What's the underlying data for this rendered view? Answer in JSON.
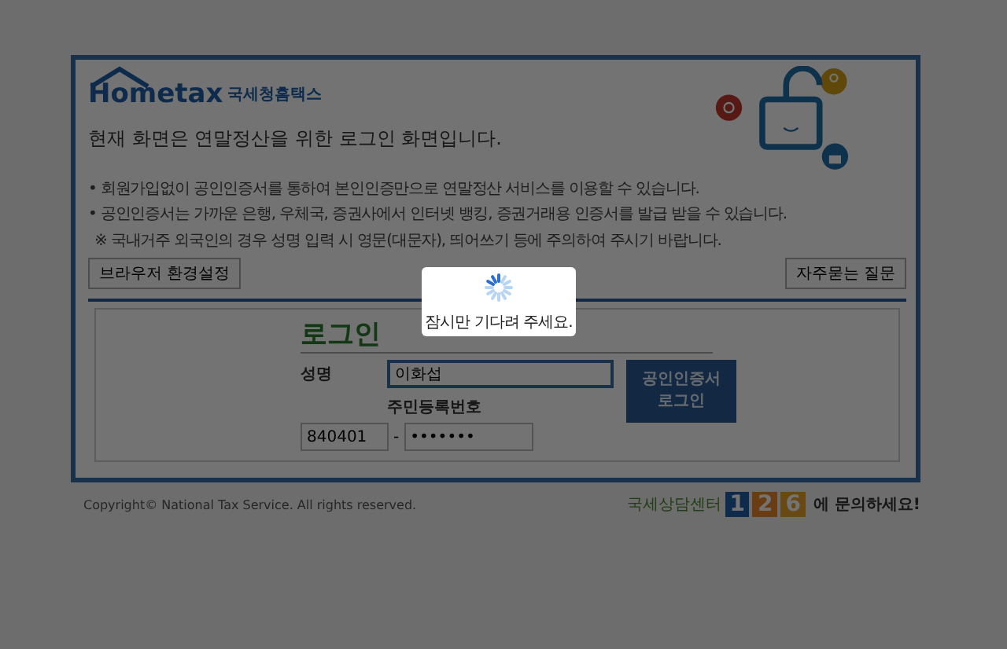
{
  "header": {
    "logo_text": "Hometax",
    "logo_subtitle": "국세청홈택스",
    "title": "현재 화면은 연말정산을 위한 로그인 화면입니다."
  },
  "notices": [
    {
      "kind": "bullet",
      "marker": "•",
      "text": "회원가입없이 공인인증서를 통하여 본인인증만으로 연말정산 서비스를 이용할 수 있습니다."
    },
    {
      "kind": "bullet",
      "marker": "•",
      "text": "공인인증서는 가까운 은행, 우체국, 증권사에서 인터넷 뱅킹, 증권거래용 인증서를 발급 받을 수 있습니다."
    },
    {
      "kind": "note",
      "marker": "※",
      "text": "국내거주 외국인의 경우 성명 입력 시 영문(대문자), 띄어쓰기 등에 주의하여 주시기 바랍니다."
    }
  ],
  "buttons": {
    "browser_settings": "브라우저 환경설정",
    "faq": "자주묻는 질문"
  },
  "login": {
    "title": "로그인",
    "name_label": "성명",
    "name_value": "이화섭",
    "id_label": "주민등록번호",
    "id_front": "840401",
    "separator": "-",
    "id_back": "•••••••",
    "submit_line1": "공인인증서",
    "submit_line2": "로그인"
  },
  "footer": {
    "copyright": "Copyright© National Tax Service. All rights reserved.",
    "center_name": "국세상담센터",
    "digits": [
      "1",
      "2",
      "6"
    ],
    "contact": "에 문의하세요!"
  },
  "loading": {
    "message": "잠시만 기다려 주세요."
  }
}
